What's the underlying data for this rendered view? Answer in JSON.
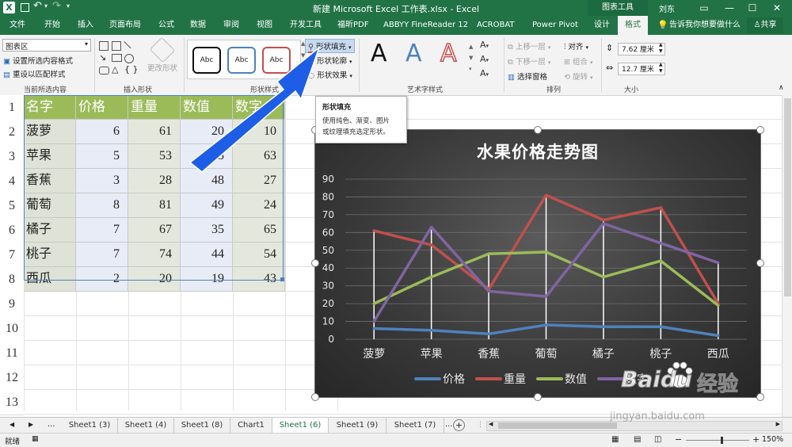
{
  "titlebar": {
    "title": "新建 Microsoft Excel 工作表.xlsx  -  Excel",
    "context_tools": "图表工具",
    "user": "刘东",
    "colors": {
      "excel_green": "#217346"
    }
  },
  "tabs": [
    "文件",
    "开始",
    "插入",
    "页面布局",
    "公式",
    "数据",
    "审阅",
    "视图",
    "开发工具",
    "福昕PDF",
    "ABBYY FineReader 12",
    "ACROBAT",
    "Power Pivot",
    "设计",
    "格式"
  ],
  "active_tab": "格式",
  "tell_me": "告诉我你想要做什么",
  "share": "共享",
  "ribbon": {
    "current_selection": {
      "dropdown": "图表区",
      "format_selection": "设置所选内容格式",
      "reset_style": "重设以匹配样式",
      "label": "当前所选内容"
    },
    "insert_shapes": {
      "change_shape": "更改形状",
      "label": "插入形状"
    },
    "shape_styles": {
      "sample": "Abc",
      "fill": "形状填充",
      "outline": "形状轮廓",
      "effects": "形状效果",
      "label": "形状样式"
    },
    "wordart": {
      "sample": "A",
      "label": "艺术字样式"
    },
    "arrange": {
      "bring_forward": "上移一层",
      "send_backward": "下移一层",
      "selection_pane": "选择窗格",
      "align": "对齐",
      "group": "组合",
      "rotate": "旋转",
      "label": "排列"
    },
    "size": {
      "height": "7.62 厘米",
      "width": "12.7 厘米",
      "label": "大小"
    }
  },
  "tooltip": {
    "title": "形状填充",
    "body_line1": "使用纯色、渐变、图片",
    "body_line2": "或纹理填充选定形状。"
  },
  "row_numbers": [
    "1",
    "2",
    "3",
    "4",
    "5",
    "6",
    "7",
    "8",
    "9",
    "10",
    "11",
    "12",
    "13"
  ],
  "table": {
    "headers": [
      "名字",
      "价格",
      "重量",
      "数值",
      "数字"
    ],
    "rows": [
      [
        "菠萝",
        "6",
        "61",
        "20",
        "10"
      ],
      [
        "苹果",
        "5",
        "53",
        "35",
        "63"
      ],
      [
        "香蕉",
        "3",
        "28",
        "48",
        "27"
      ],
      [
        "葡萄",
        "8",
        "81",
        "49",
        "24"
      ],
      [
        "橘子",
        "7",
        "67",
        "35",
        "65"
      ],
      [
        "桃子",
        "7",
        "74",
        "44",
        "54"
      ],
      [
        "西瓜",
        "2",
        "20",
        "19",
        "43"
      ]
    ]
  },
  "chart_data": {
    "type": "line",
    "title": "水果价格走势图",
    "categories": [
      "菠萝",
      "苹果",
      "香蕉",
      "葡萄",
      "橘子",
      "桃子",
      "西瓜"
    ],
    "series": [
      {
        "name": "价格",
        "values": [
          6,
          5,
          3,
          8,
          7,
          7,
          2
        ],
        "color": "#4f81bd"
      },
      {
        "name": "重量",
        "values": [
          61,
          53,
          28,
          81,
          67,
          74,
          20
        ],
        "color": "#c0504d"
      },
      {
        "name": "数值",
        "values": [
          20,
          35,
          48,
          49,
          35,
          44,
          19
        ],
        "color": "#9bbb59"
      },
      {
        "name": "数字",
        "values": [
          10,
          63,
          27,
          24,
          65,
          54,
          43
        ],
        "color": "#8064a2"
      }
    ],
    "ylim": [
      0,
      90
    ],
    "yticks": [
      "0",
      "10",
      "20",
      "30",
      "40",
      "50",
      "60",
      "70",
      "80",
      "90"
    ],
    "legend": "bottom",
    "grid": true,
    "drop_lines": true
  },
  "sheet_tabs": [
    "Sheet1 (3)",
    "Sheet1 (4)",
    "Sheet1 (8)",
    "Chart1",
    "Sheet1 (6)",
    "Sheet1 (9)",
    "Sheet1 (7)"
  ],
  "active_sheet": "Sheet1 (6)",
  "ellipsis": "...",
  "status": {
    "ready": "就绪",
    "zoom": "150%"
  },
  "watermark": {
    "brand": "Baidu",
    "sub": "经验",
    "url": "jingyan.baidu.com"
  }
}
